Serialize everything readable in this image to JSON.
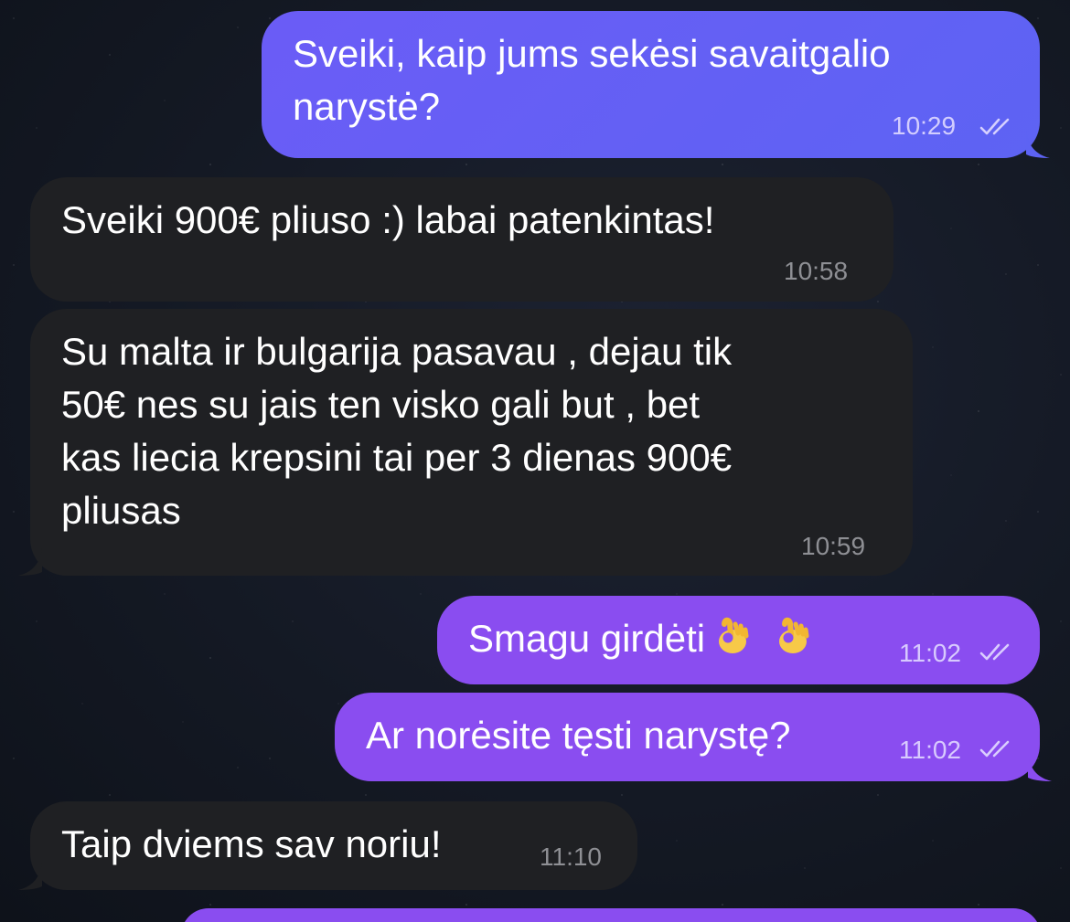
{
  "messages": [
    {
      "id": 1,
      "direction": "outgoing",
      "text": "Sveiki, kaip jums sekėsi savaitgalio\nnarystė?",
      "time": "10:29",
      "status": "read"
    },
    {
      "id": 2,
      "direction": "incoming",
      "text": "Sveiki 900€ pliuso :) labai patenkintas!",
      "time": "10:58"
    },
    {
      "id": 3,
      "direction": "incoming",
      "text": "Su malta ir bulgarija pasavau , dejau tik\n50€ nes su jais ten visko gali but , bet\nkas liecia krepsini tai per 3 dienas 900€\npliusas",
      "time": "10:59"
    },
    {
      "id": 4,
      "direction": "outgoing",
      "text": "Smagu girdėti",
      "emojis": [
        "ok-hand-emoji",
        "ok-hand-emoji"
      ],
      "time": "11:02",
      "status": "read"
    },
    {
      "id": 5,
      "direction": "outgoing",
      "text": "Ar norėsite tęsti narystę?",
      "time": "11:02",
      "status": "read"
    },
    {
      "id": 6,
      "direction": "incoming",
      "text": "Taip dviems sav noriu!",
      "time": "11:10"
    }
  ],
  "colors": {
    "outgoing_blue": "#5d63f3",
    "outgoing_purple": "#8a4df0",
    "incoming": "#1f2023",
    "incoming_time": "#8e8f94"
  },
  "icons": {
    "read_status": "double-check-icon",
    "emoji": "ok-hand-emoji"
  }
}
